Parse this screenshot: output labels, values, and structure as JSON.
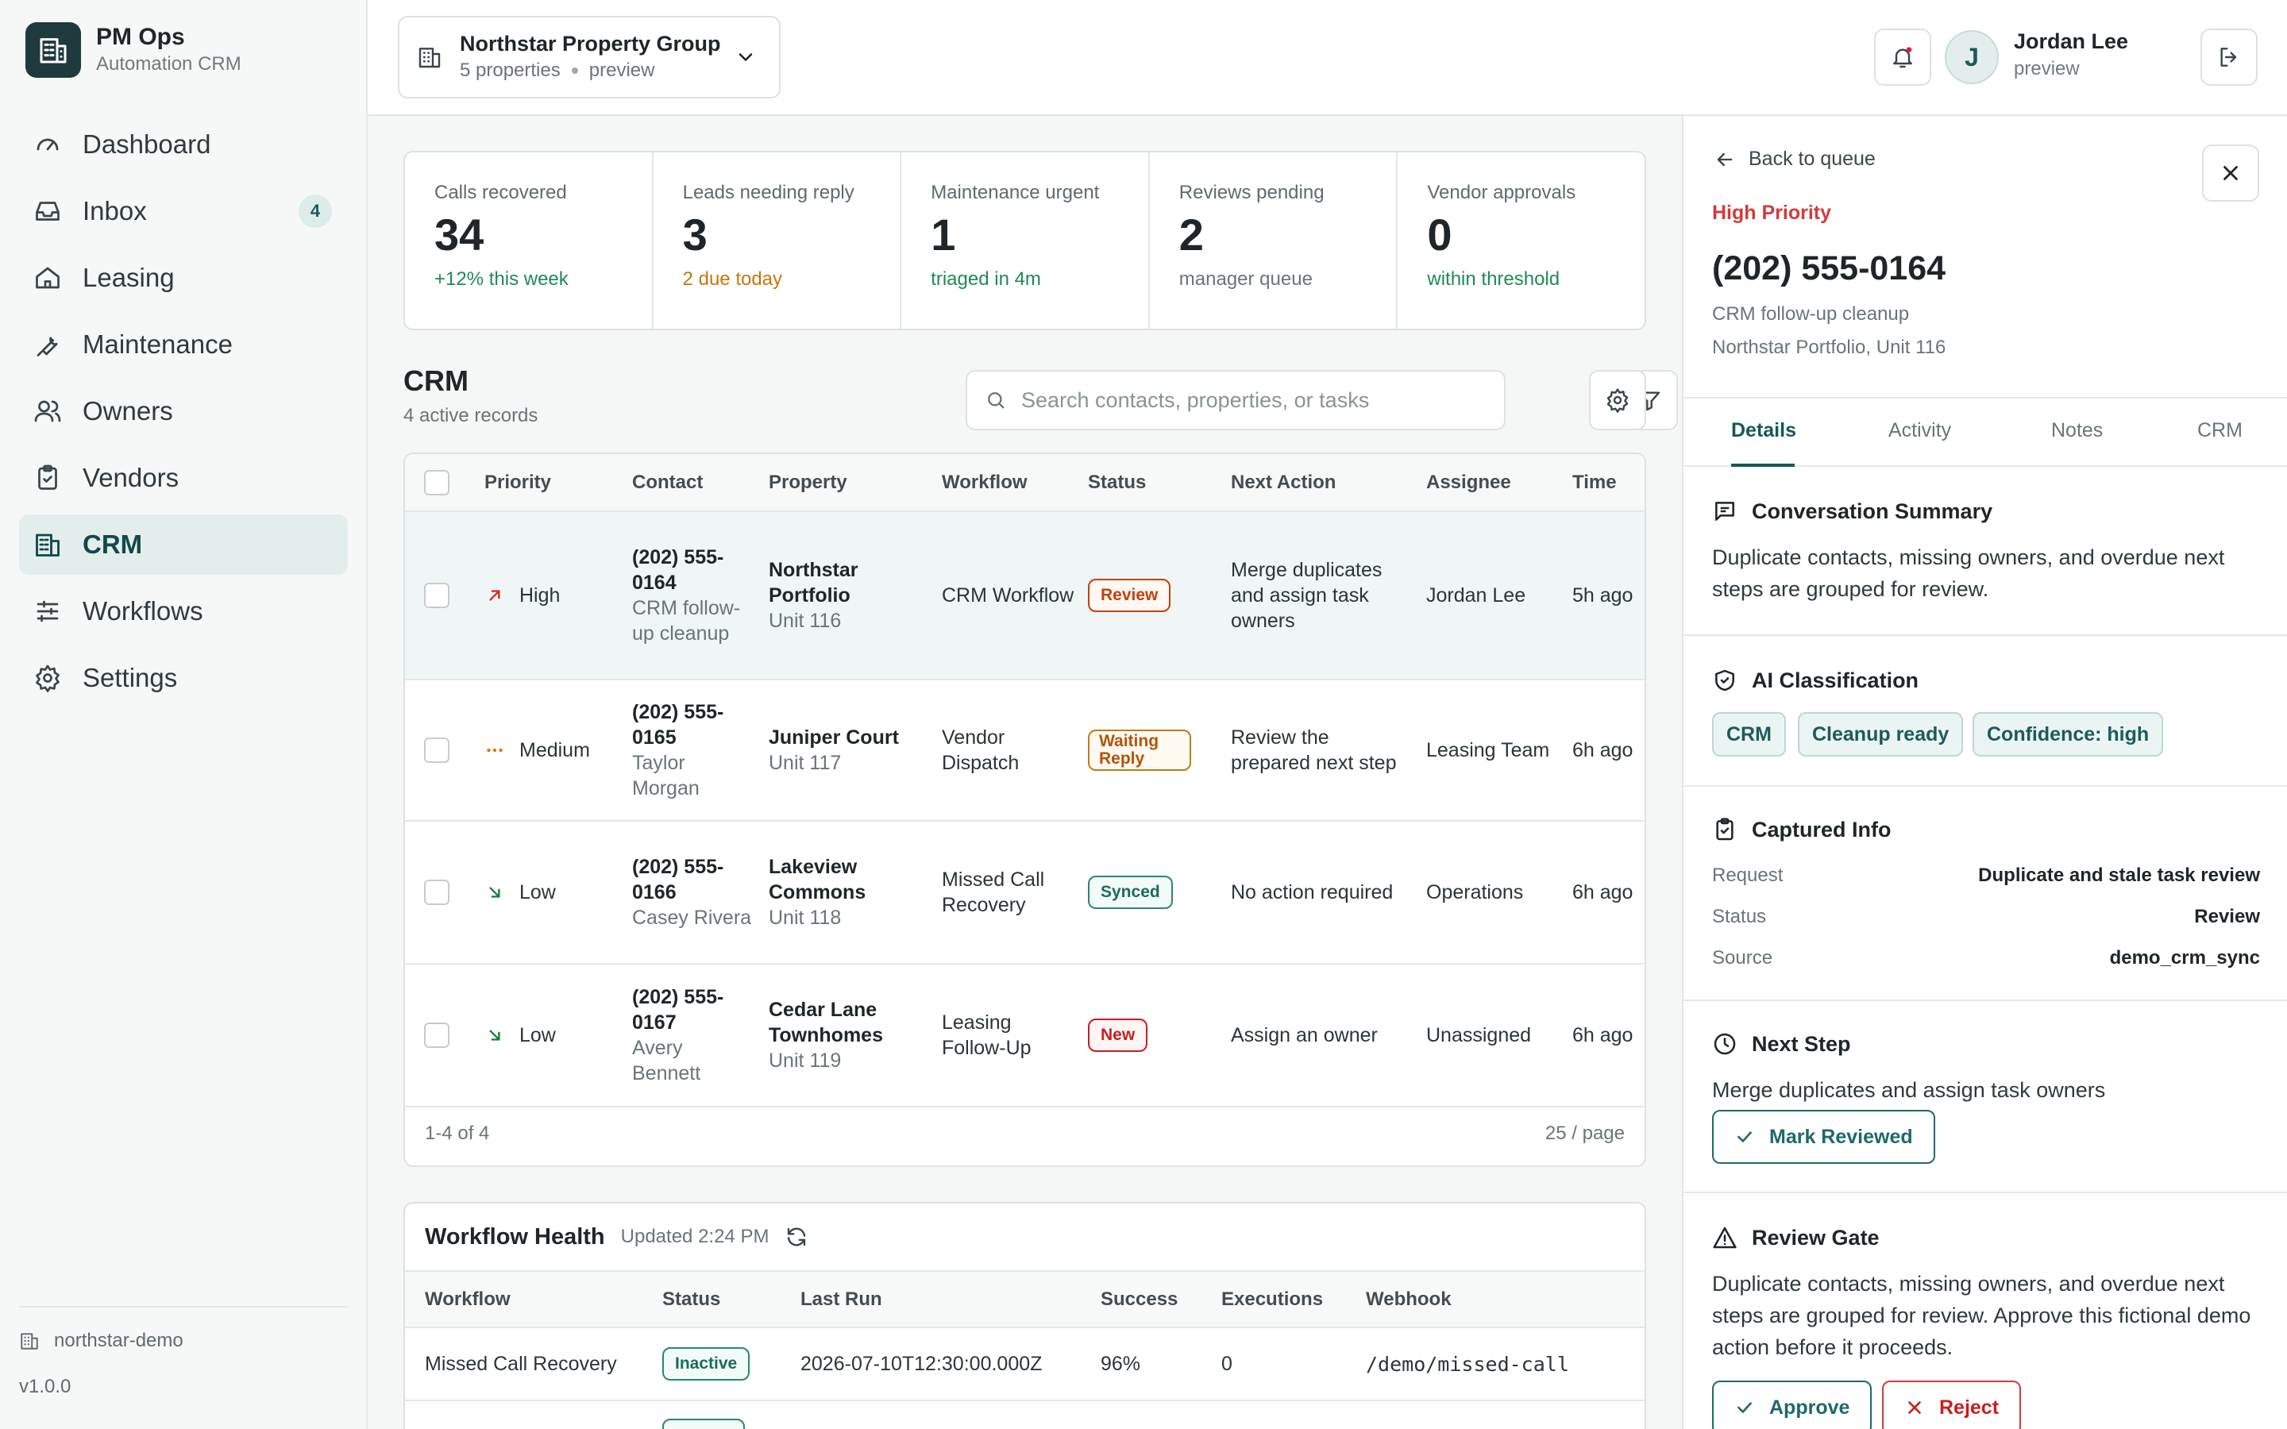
{
  "brand": {
    "name": "PM Ops",
    "subtitle": "Automation CRM"
  },
  "nav": [
    {
      "label": "Dashboard",
      "icon": "gauge-icon"
    },
    {
      "label": "Inbox",
      "icon": "inbox-icon",
      "badge": "4"
    },
    {
      "label": "Leasing",
      "icon": "home-icon"
    },
    {
      "label": "Maintenance",
      "icon": "wrench-icon"
    },
    {
      "label": "Owners",
      "icon": "users-icon"
    },
    {
      "label": "Vendors",
      "icon": "clipboard-check-icon"
    },
    {
      "label": "CRM",
      "icon": "building-icon",
      "active": true
    },
    {
      "label": "Workflows",
      "icon": "sliders-icon"
    },
    {
      "label": "Settings",
      "icon": "gear-icon"
    }
  ],
  "sidebar_footer": {
    "tenant": "northstar-demo",
    "version": "v1.0.0"
  },
  "org": {
    "name": "Northstar Property Group",
    "properties": "5 properties",
    "mode": "preview"
  },
  "user": {
    "initial": "J",
    "name": "Jordan Lee",
    "mode": "preview"
  },
  "stats": [
    {
      "label": "Calls recovered",
      "value": "34",
      "note": "+12% this week",
      "tone": "green"
    },
    {
      "label": "Leads needing reply",
      "value": "3",
      "note": "2 due today",
      "tone": "amber"
    },
    {
      "label": "Maintenance urgent",
      "value": "1",
      "note": "triaged in 4m",
      "tone": "green"
    },
    {
      "label": "Reviews pending",
      "value": "2",
      "note": "manager queue",
      "tone": "muted"
    },
    {
      "label": "Vendor approvals",
      "value": "0",
      "note": "within threshold",
      "tone": "green"
    }
  ],
  "crm": {
    "title": "CRM",
    "subtitle": "4 active records",
    "search_placeholder": "Search contacts, properties, or tasks",
    "columns": [
      "Priority",
      "Contact",
      "Property",
      "Workflow",
      "Status",
      "Next Action",
      "Assignee",
      "Time"
    ],
    "rows": [
      {
        "priority": "High",
        "phone": "(202) 555-0164",
        "contact": "CRM follow-up cleanup",
        "property": "Northstar Portfolio",
        "unit": "Unit 116",
        "workflow": "CRM Workflow",
        "status": "Review",
        "next": "Merge duplicates and assign task owners",
        "assignee": "Jordan Lee",
        "time": "5h ago"
      },
      {
        "priority": "Medium",
        "phone": "(202) 555-0165",
        "contact": "Taylor Morgan",
        "property": "Juniper Court",
        "unit": "Unit 117",
        "workflow": "Vendor Dispatch",
        "status": "Waiting Reply",
        "next": "Review the prepared next step",
        "assignee": "Leasing Team",
        "time": "6h ago"
      },
      {
        "priority": "Low",
        "phone": "(202) 555-0166",
        "contact": "Casey Rivera",
        "property": "Lakeview Commons",
        "unit": "Unit 118",
        "workflow": "Missed Call Recovery",
        "status": "Synced",
        "next": "No action required",
        "assignee": "Operations",
        "time": "6h ago"
      },
      {
        "priority": "Low",
        "phone": "(202) 555-0167",
        "contact": "Avery Bennett",
        "property": "Cedar Lane Townhomes",
        "unit": "Unit 119",
        "workflow": "Leasing Follow-Up",
        "status": "New",
        "next": "Assign an owner",
        "assignee": "Unassigned",
        "time": "6h ago"
      }
    ],
    "range": "1-4 of 4",
    "page_size": "25 / page"
  },
  "workflow_health": {
    "title": "Workflow Health",
    "updated": "Updated 2:24 PM",
    "columns": [
      "Workflow",
      "Status",
      "Last Run",
      "Success",
      "Executions",
      "Webhook"
    ],
    "rows": [
      {
        "workflow": "Missed Call Recovery",
        "status": "Inactive",
        "last_run": "2026-07-10T12:30:00.000Z",
        "success": "96%",
        "executions": "0",
        "webhook": "/demo/missed-call"
      }
    ]
  },
  "detail": {
    "back": "Back to queue",
    "priority": "High Priority",
    "phone": "(202) 555-0164",
    "subtitle": "CRM follow-up cleanup",
    "location": "Northstar Portfolio, Unit 116",
    "tabs": [
      "Details",
      "Activity",
      "Notes",
      "CRM"
    ],
    "summary_title": "Conversation Summary",
    "summary": "Duplicate contacts, missing owners, and overdue next steps are grouped for review.",
    "ai_title": "AI Classification",
    "ai_tags": [
      "CRM",
      "Cleanup ready",
      "Confidence: high"
    ],
    "captured_title": "Captured Info",
    "captured": [
      {
        "k": "Request",
        "v": "Duplicate and stale task review"
      },
      {
        "k": "Status",
        "v": "Review"
      },
      {
        "k": "Source",
        "v": "demo_crm_sync"
      }
    ],
    "next_title": "Next Step",
    "next": "Merge duplicates and assign task owners",
    "mark_reviewed": "Mark Reviewed",
    "gate_title": "Review Gate",
    "gate_text": "Duplicate contacts, missing owners, and overdue next steps are grouped for review. Approve this fictional demo action before it proceeds.",
    "approve": "Approve",
    "reject": "Reject"
  }
}
